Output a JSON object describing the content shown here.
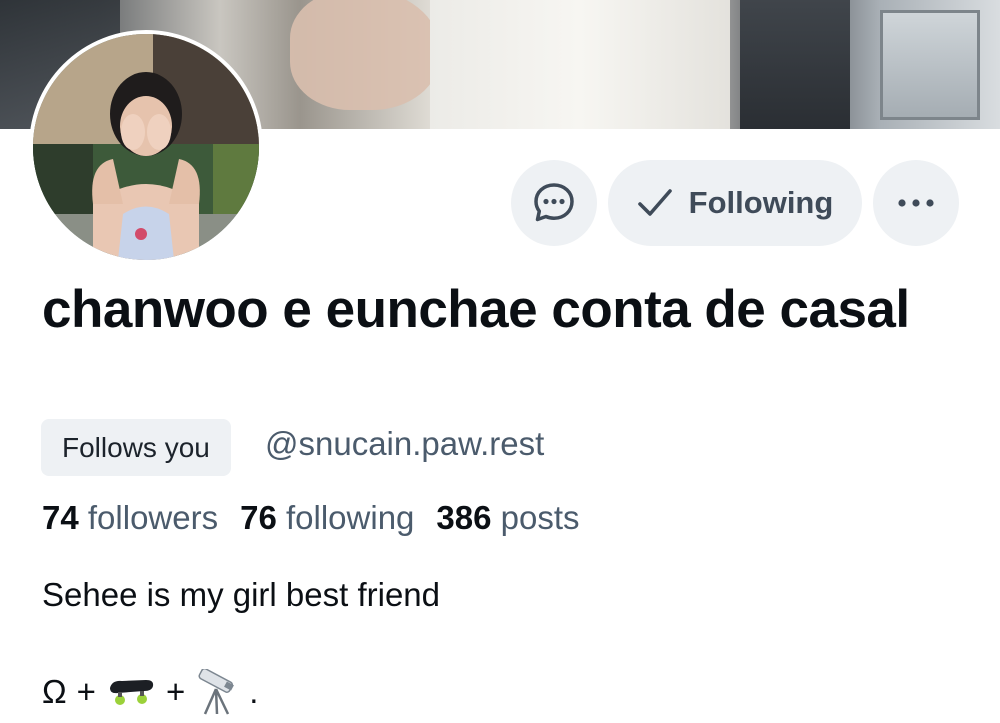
{
  "profile": {
    "display_name": "chanwoo e eunchae conta de casal",
    "follows_you": "Follows you",
    "handle": "@snucain.paw.rest"
  },
  "actions": {
    "following_label": "Following",
    "message_icon": "message-icon",
    "more_icon": "more-icon",
    "check_icon": "check-icon"
  },
  "stats": {
    "followers_count": "74",
    "followers_label": "followers",
    "following_count": "76",
    "following_label": "following",
    "posts_count": "386",
    "posts_label": "posts"
  },
  "bio": {
    "line1": "Sehee is my girl best friend",
    "line2_omega": "Ω",
    "line2_plus1": "+",
    "line2_plus2": "+",
    "line2_end": ".",
    "emoji_1": "skateboard-icon",
    "emoji_2": "telescope-icon"
  },
  "colors": {
    "button_bg": "#eef1f4",
    "text_primary": "#0b0f14",
    "text_secondary": "#4b5b6c"
  }
}
